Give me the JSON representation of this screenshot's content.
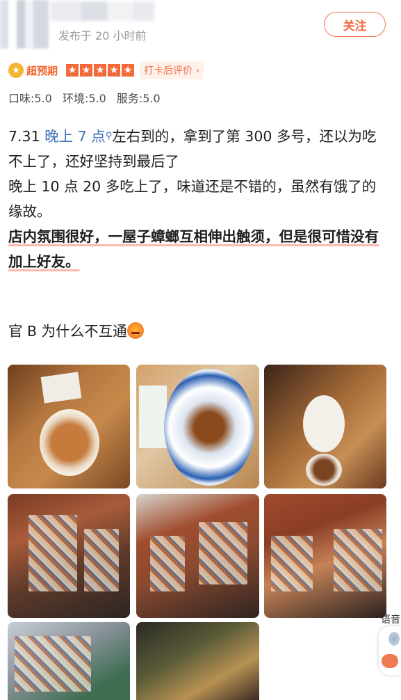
{
  "post": {
    "time": "发布于 20 小时前",
    "follow_label": "关注"
  },
  "rating": {
    "badge_label": "超预期",
    "stars": 5,
    "checkin_label": "打卡后评价 ›",
    "scores": [
      "口味:5.0",
      "环境:5.0",
      "服务:5.0"
    ]
  },
  "content": {
    "line1_prefix": "7.31 ",
    "line1_link": "晚上 7 点",
    "line1_suffix": "左右到的，拿到了第 300 多号，还以为吃不上了，还好坚持到最后了",
    "para2": "晚上 10 点 20 多吃上了，味道还是不错的，虽然有饿了的缘故。",
    "para3": "店内氛围很好，一屋子蟑螂互相伸出触须，但是很可惜没有加上好友。",
    "para4": "官 B 为什么不互通"
  },
  "photos": {
    "count": 8
  },
  "voice": {
    "label": "语音"
  },
  "colors": {
    "accent": "#f06a3e",
    "link": "#3e6fb8"
  }
}
